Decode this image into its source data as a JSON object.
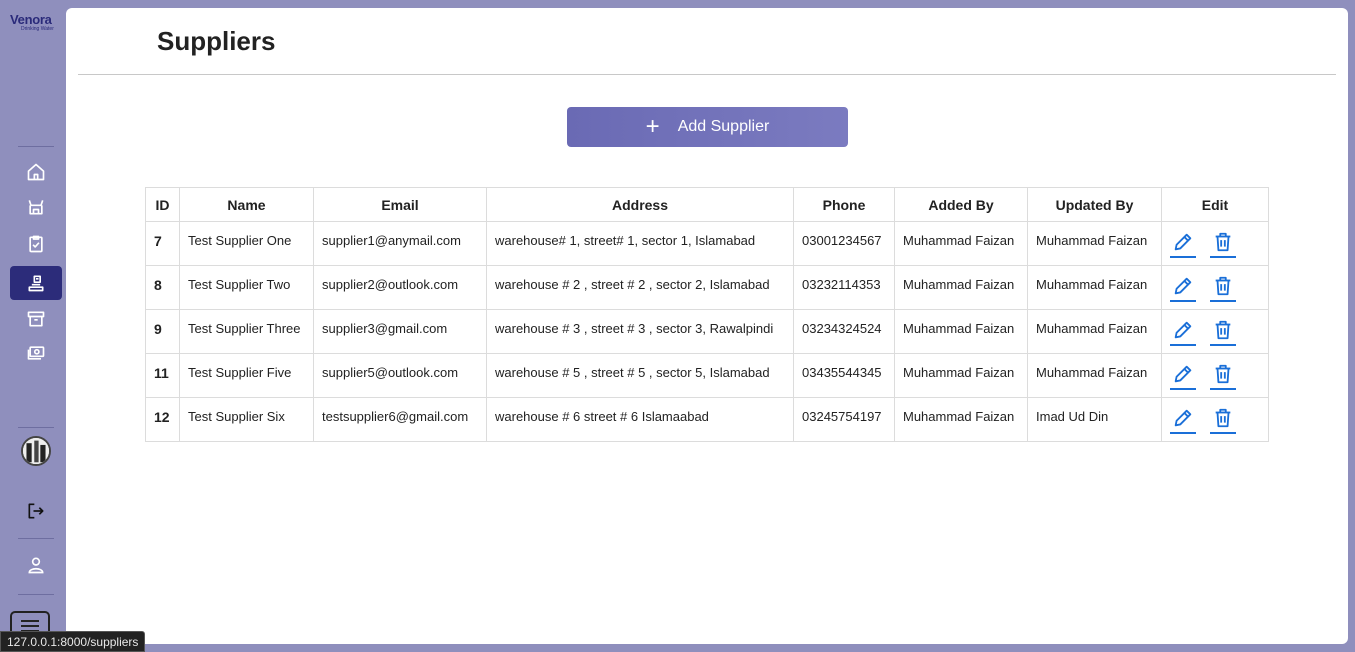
{
  "brand": {
    "name": "Venora",
    "tagline": "Drinking Water"
  },
  "sidebar": {
    "items": [
      {
        "name": "home",
        "active": false
      },
      {
        "name": "store",
        "active": false
      },
      {
        "name": "orders",
        "active": false
      },
      {
        "name": "suppliers",
        "active": true
      },
      {
        "name": "archive",
        "active": false
      },
      {
        "name": "payments",
        "active": false
      }
    ]
  },
  "page": {
    "title": "Suppliers"
  },
  "actions": {
    "add_label": "Add Supplier",
    "add_icon": "+"
  },
  "table": {
    "headers": [
      "ID",
      "Name",
      "Email",
      "Address",
      "Phone",
      "Added By",
      "Updated By",
      "Edit"
    ],
    "rows": [
      {
        "id": "7",
        "name": "Test Supplier One",
        "email": "supplier1@anymail.com",
        "address": "warehouse# 1, street# 1, sector 1, Islamabad",
        "phone": "03001234567",
        "added_by": "Muhammad Faizan",
        "updated_by": "Muhammad Faizan"
      },
      {
        "id": "8",
        "name": "Test Supplier Two",
        "email": "supplier2@outlook.com",
        "address": "warehouse # 2 , street # 2 , sector 2, Islamabad",
        "phone": "03232114353",
        "added_by": "Muhammad Faizan",
        "updated_by": "Muhammad Faizan"
      },
      {
        "id": "9",
        "name": "Test Supplier Three",
        "email": "supplier3@gmail.com",
        "address": "warehouse # 3 , street # 3 , sector 3, Rawalpindi",
        "phone": "03234324524",
        "added_by": "Muhammad Faizan",
        "updated_by": "Muhammad Faizan"
      },
      {
        "id": "11",
        "name": "Test Supplier Five",
        "email": "supplier5@outlook.com",
        "address": "warehouse # 5 , street # 5 , sector 5, Islamabad",
        "phone": "03435544345",
        "added_by": "Muhammad Faizan",
        "updated_by": "Muhammad Faizan"
      },
      {
        "id": "12",
        "name": "Test Supplier Six",
        "email": "testsupplier6@gmail.com",
        "address": "warehouse # 6 street # 6 Islamaabad",
        "phone": "03245754197",
        "added_by": "Muhammad Faizan",
        "updated_by": "Imad Ud Din"
      }
    ]
  },
  "status_url": "127.0.0.1:8000/suppliers",
  "colors": {
    "accent": "#6a6ab4",
    "sidebar_bg": "#8f8fbd",
    "active_nav": "#2c2c7a",
    "icon_blue": "#1a6fd8"
  }
}
